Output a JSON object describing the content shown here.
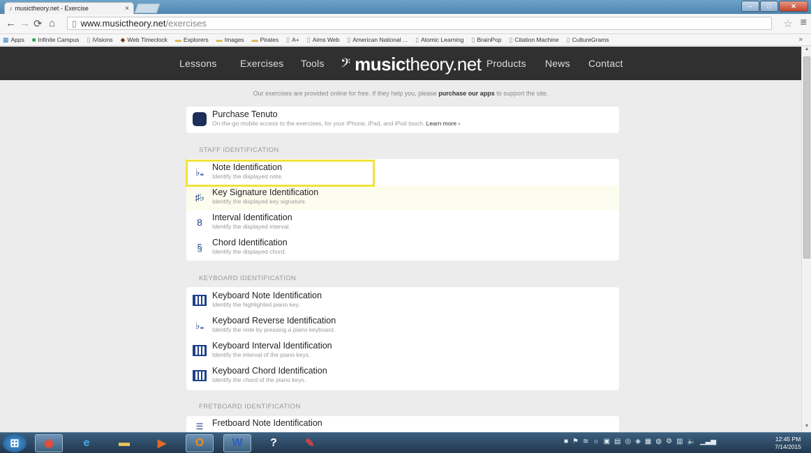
{
  "browser": {
    "tab_title": "musictheory.net - Exercise",
    "url_domain": "www.musictheory.net",
    "url_path": "/exercises",
    "bookmarks": [
      "Apps",
      "Infinite Campus",
      "iVisions",
      "Web Timeclock",
      "Explorers",
      "Images",
      "Pirates",
      "A+",
      "Aims Web",
      "American National ...",
      "Atomic Learning",
      "BrainPop",
      "Citation Machine",
      "CultureGrams"
    ],
    "bookmarks_more": "»"
  },
  "site_nav": {
    "lessons": "Lessons",
    "exercises": "Exercises",
    "tools": "Tools",
    "logo_part1": "music",
    "logo_part2": "theory.net",
    "products": "Products",
    "news": "News",
    "contact": "Contact"
  },
  "promo": {
    "before": "Our exercises are provided online for free. If they help you, please",
    "bold": "purchase our apps",
    "after": "to support the site."
  },
  "tenuto": {
    "title": "Purchase Tenuto",
    "subtitle": "On-the-go mobile access to the exercises, for your iPhone, iPad, and iPod touch.",
    "learn_more": "Learn more ›"
  },
  "sections": {
    "staff": "STAFF IDENTIFICATION",
    "keyboard": "KEYBOARD IDENTIFICATION",
    "fretboard": "FRETBOARD IDENTIFICATION"
  },
  "staff_items": [
    {
      "title": "Note Identification",
      "subtitle": "Identify the displayed note.",
      "icon": "note-icon"
    },
    {
      "title": "Key Signature Identification",
      "subtitle": "Identify the displayed key signature.",
      "icon": "key-signature-icon"
    },
    {
      "title": "Interval Identification",
      "subtitle": "Identify the displayed interval.",
      "icon": "interval-icon"
    },
    {
      "title": "Chord Identification",
      "subtitle": "Identify the displayed chord.",
      "icon": "chord-icon"
    }
  ],
  "keyboard_items": [
    {
      "title": "Keyboard Note Identification",
      "subtitle": "Identify the highlighted piano key.",
      "icon": "keyboard-icon"
    },
    {
      "title": "Keyboard Reverse Identification",
      "subtitle": "Identify the note by pressing a piano keyboard.",
      "icon": "note-icon"
    },
    {
      "title": "Keyboard Interval Identification",
      "subtitle": "Identify the interval of the piano keys.",
      "icon": "keyboard-icon"
    },
    {
      "title": "Keyboard Chord Identification",
      "subtitle": "Identify the chord of the piano keys.",
      "icon": "keyboard-icon"
    }
  ],
  "fretboard_items": [
    {
      "title": "Fretboard Note Identification",
      "subtitle": "",
      "icon": "fretboard-icon"
    }
  ],
  "taskbar": {
    "time": "12:45 PM",
    "date": "7/14/2015"
  },
  "colors": {
    "nav_bg": "#303030",
    "highlight_box": "#f1e23a",
    "icon_blue": "#1e3f8b"
  }
}
